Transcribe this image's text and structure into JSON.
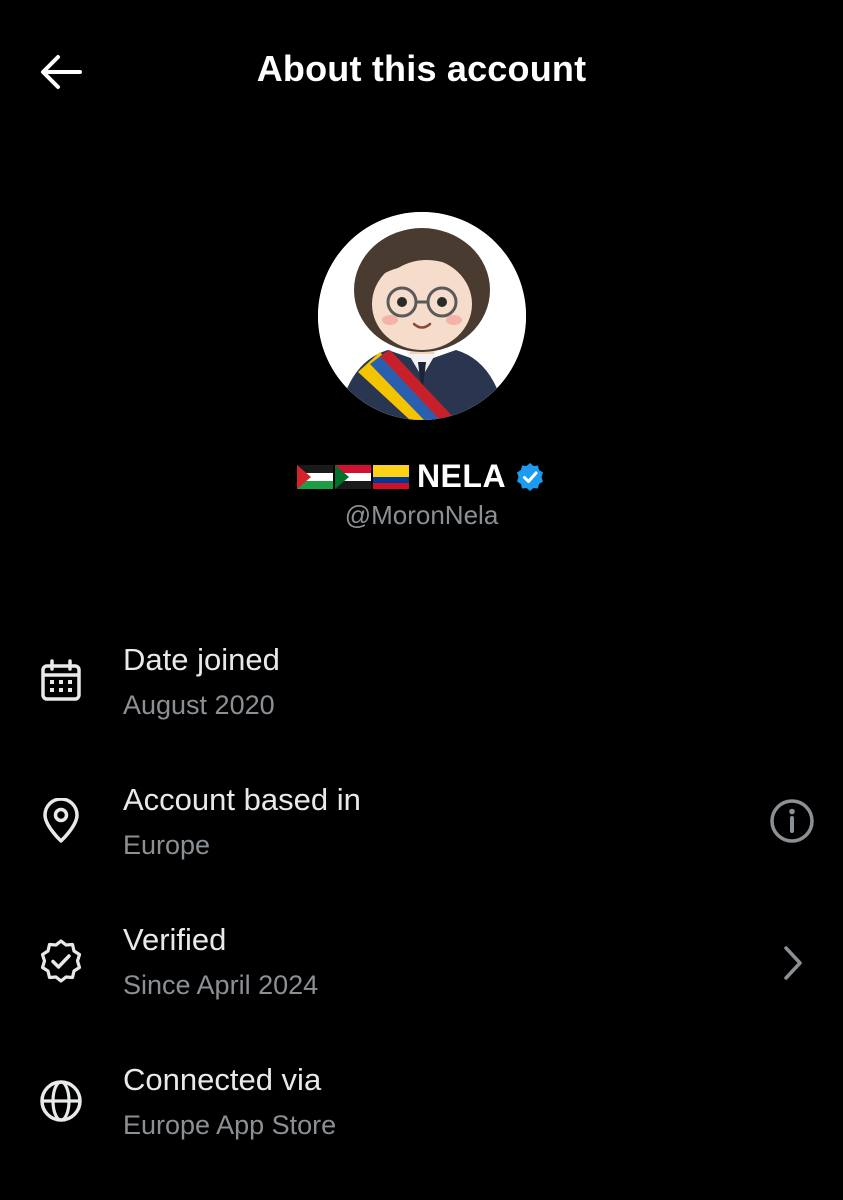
{
  "header": {
    "title": "About this account",
    "back_icon": "arrow-left-icon"
  },
  "profile": {
    "avatar_icon": "profile-avatar",
    "flags": [
      "palestine-flag",
      "sudan-flag",
      "colombia-flag"
    ],
    "display_name": "NELA",
    "verified_icon": "verified-badge-icon",
    "verified_color": "#1d9bf0",
    "handle": "@MoronNela"
  },
  "details": [
    {
      "label": "Date joined",
      "value": "August 2020",
      "icon": "calendar-icon",
      "action": null
    },
    {
      "label": "Account based in",
      "value": "Europe",
      "icon": "location-pin-icon",
      "action": "info-icon"
    },
    {
      "label": "Verified",
      "value": "Since April 2024",
      "icon": "verified-seal-icon",
      "action": "chevron-right-icon"
    },
    {
      "label": "Connected via",
      "value": "Europe App Store",
      "icon": "globe-icon",
      "action": null
    }
  ],
  "colors": {
    "background": "#000000",
    "primary_text": "#e7e9ea",
    "secondary_text": "#8b9095",
    "accent": "#1d9bf0"
  }
}
